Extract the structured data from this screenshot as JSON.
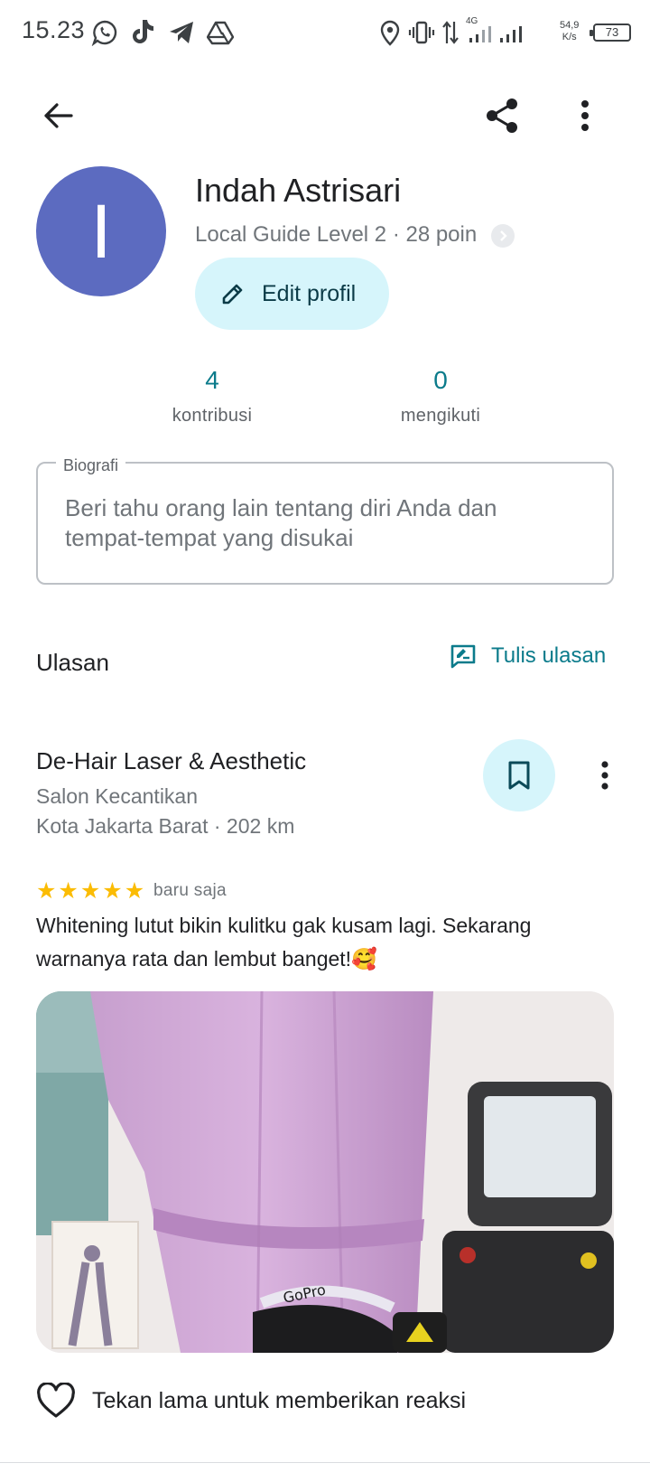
{
  "status_bar": {
    "time": "15.23",
    "network_type": "4G",
    "net_speed_value": "54,9",
    "net_speed_unit": "K/s",
    "battery": "73"
  },
  "profile": {
    "avatar_initial": "I",
    "avatar_color": "#5c6bc0",
    "name": "Indah Astrisari",
    "guide_meta": "Local Guide Level 2 · 28 poin",
    "edit_label": "Edit profil"
  },
  "stats": [
    {
      "value": "4",
      "label": "kontribusi"
    },
    {
      "value": "0",
      "label": "mengikuti"
    }
  ],
  "bio": {
    "legend": "Biografi",
    "placeholder": "Beri tahu orang lain tentang diri Anda dan tempat-tempat yang disukai"
  },
  "reviews_section": {
    "title": "Ulasan",
    "write_label": "Tulis ulasan"
  },
  "review": {
    "place_name": "De-Hair Laser & Aesthetic",
    "category": "Salon Kecantikan",
    "location": "Kota Jakarta Barat · 202 km",
    "rating": 5,
    "time": "baru saja",
    "text": "Whitening lutut bikin kulitku gak kusam lagi. Sekarang warnanya rata dan lembut banget!🥰",
    "photo_text": "GoPro"
  },
  "reaction": {
    "label": "Tekan lama untuk memberikan reaksi"
  },
  "colors": {
    "accent": "#0b7b8b",
    "chip_bg": "#d6f5fb",
    "star": "#fbbc04"
  }
}
